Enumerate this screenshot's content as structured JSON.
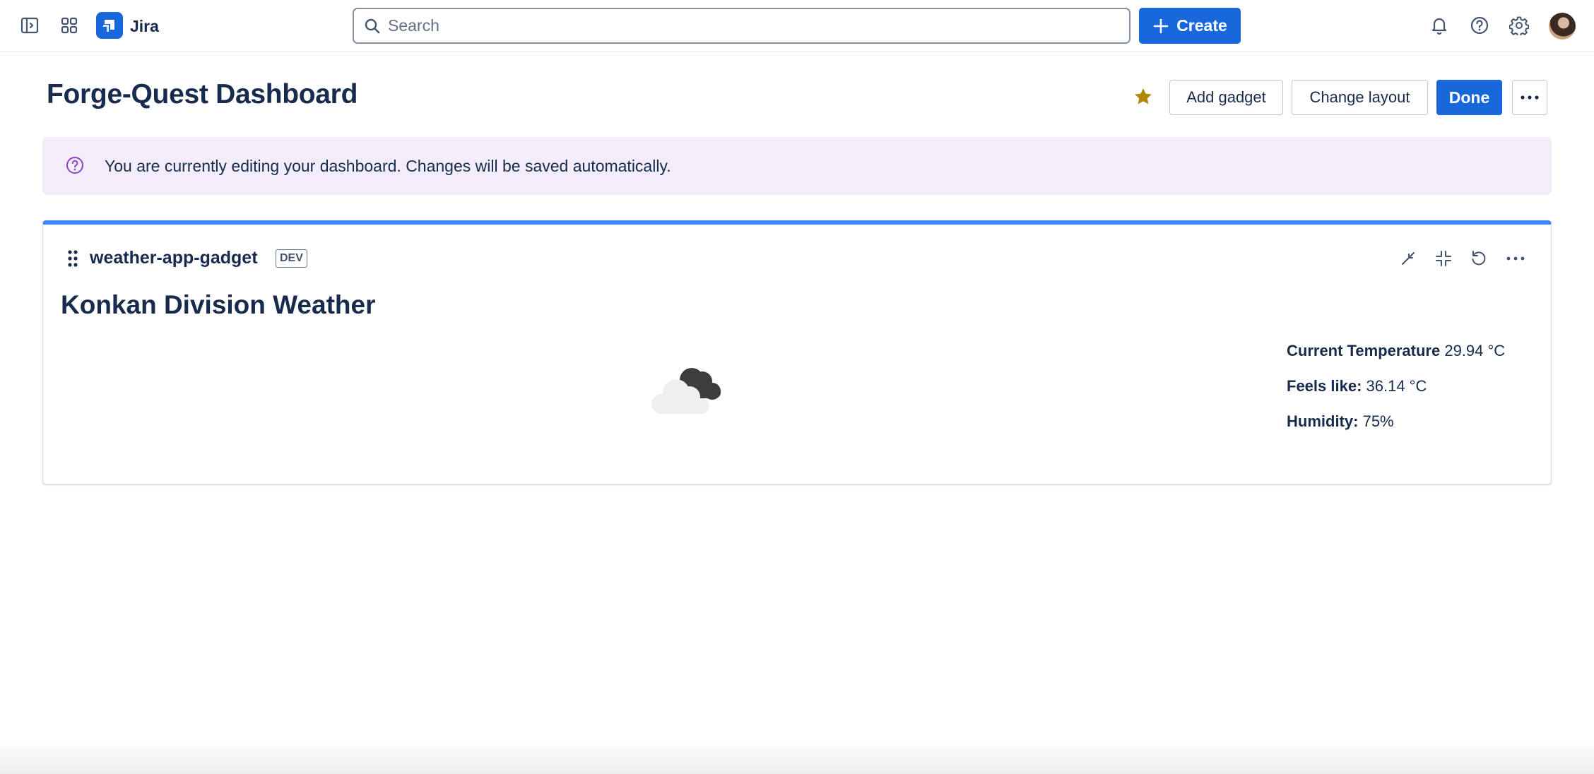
{
  "app": {
    "name": "Jira",
    "accent": "#1868db"
  },
  "nav": {
    "search_placeholder": "Search",
    "create_label": "Create"
  },
  "page": {
    "title": "Forge-Quest Dashboard",
    "add_gadget_label": "Add gadget",
    "change_layout_label": "Change layout",
    "done_label": "Done"
  },
  "banner": {
    "text": "You are currently editing your dashboard. Changes will be saved automatically.",
    "background": "#f3edfb"
  },
  "gadget": {
    "name": "weather-app-gadget",
    "badge": "DEV",
    "title": "Konkan Division Weather",
    "top_border_color": "#388bff",
    "stats": [
      {
        "label": "Current Temperature",
        "value": "29.94 °C"
      },
      {
        "label": "Feels like:",
        "value": "36.14 °C"
      },
      {
        "label": "Humidity:",
        "value": "75%"
      }
    ]
  }
}
